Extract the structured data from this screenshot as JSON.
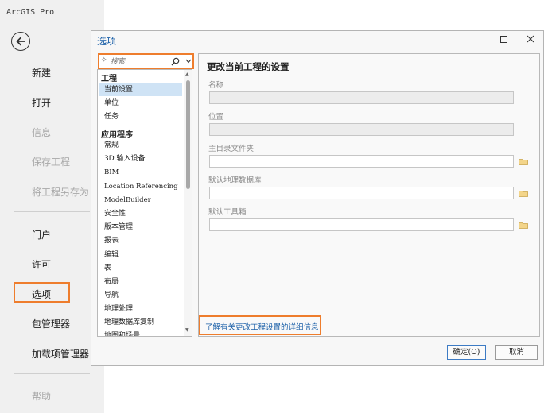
{
  "app": {
    "title": "ArcGIS Pro"
  },
  "sidebar": {
    "items": [
      {
        "label": "新建",
        "enabled": true
      },
      {
        "label": "打开",
        "enabled": true
      },
      {
        "label": "信息",
        "enabled": false
      },
      {
        "label": "保存工程",
        "enabled": false
      },
      {
        "label": "将工程另存为",
        "enabled": false
      },
      {
        "label": "门户",
        "enabled": true
      },
      {
        "label": "许可",
        "enabled": true
      },
      {
        "label": "选项",
        "enabled": true,
        "selected": true
      },
      {
        "label": "包管理器",
        "enabled": true
      },
      {
        "label": "加载项管理器",
        "enabled": true
      },
      {
        "label": "帮助",
        "enabled": false
      }
    ]
  },
  "dialog": {
    "title": "选项",
    "search": {
      "placeholder": "搜索"
    },
    "nav": {
      "groups": [
        {
          "label": "工程",
          "items": [
            "当前设置",
            "单位",
            "任务"
          ]
        },
        {
          "label": "应用程序",
          "items": [
            "常规",
            "3D 输入设备",
            "BIM",
            "Location Referencing",
            "ModelBuilder",
            "安全性",
            "版本管理",
            "报表",
            "编辑",
            "表",
            "布局",
            "导航",
            "地理处理",
            "地理数据库复制",
            "地图和场景"
          ]
        }
      ],
      "selected_item": "当前设置"
    },
    "content": {
      "title": "更改当前工程的设置",
      "fields": [
        {
          "label": "名称",
          "value": "",
          "enabled": false
        },
        {
          "label": "位置",
          "value": "",
          "enabled": false
        },
        {
          "label": "主目录文件夹",
          "value": "",
          "enabled": true
        },
        {
          "label": "默认地理数据库",
          "value": "",
          "enabled": true
        },
        {
          "label": "默认工具箱",
          "value": "",
          "enabled": true
        }
      ],
      "learn_more": "了解有关更改工程设置的详细信息"
    },
    "buttons": {
      "ok": "确定(O)",
      "cancel": "取消"
    }
  },
  "colors": {
    "highlight": "#ee7d2d",
    "link": "#1a5fa8",
    "selection": "#cfe3f5"
  }
}
